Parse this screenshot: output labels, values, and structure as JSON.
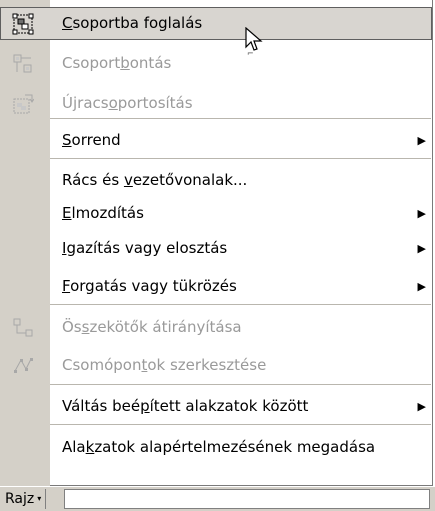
{
  "menu": {
    "items": [
      {
        "pre": "",
        "u": "C",
        "post": "soportba foglalás",
        "disabled": false,
        "hover": true,
        "submenu": false,
        "icon": "group-icon"
      },
      {
        "pre": "Csoport",
        "u": "b",
        "post": "ontás",
        "disabled": true,
        "hover": false,
        "submenu": false,
        "icon": "ungroup-icon"
      },
      {
        "pre": "Újracs",
        "u": "o",
        "post": "portosítás",
        "disabled": true,
        "hover": false,
        "submenu": false,
        "icon": "regroup-icon"
      },
      {
        "pre": "",
        "u": "S",
        "post": "orrend",
        "disabled": false,
        "hover": false,
        "submenu": true,
        "icon": ""
      },
      {
        "pre": "Rács és ",
        "u": "v",
        "post": "ezetővonalak...",
        "disabled": false,
        "hover": false,
        "submenu": false,
        "icon": ""
      },
      {
        "pre": "",
        "u": "E",
        "post": "lmozdítás",
        "disabled": false,
        "hover": false,
        "submenu": true,
        "icon": ""
      },
      {
        "pre": "",
        "u": "I",
        "post": "gazítás vagy elosztás",
        "disabled": false,
        "hover": false,
        "submenu": true,
        "icon": ""
      },
      {
        "pre": "",
        "u": "F",
        "post": "orgatás vagy tükrözés",
        "disabled": false,
        "hover": false,
        "submenu": true,
        "icon": ""
      },
      {
        "pre": "Ös",
        "u": "s",
        "post": "zekötők átirányítása",
        "disabled": true,
        "hover": false,
        "submenu": false,
        "icon": "reroute-connectors-icon"
      },
      {
        "pre": "Csomópon",
        "u": "t",
        "post": "ok szerkesztése",
        "disabled": true,
        "hover": false,
        "submenu": false,
        "icon": "edit-points-icon"
      },
      {
        "pre": "Váltás beé",
        "u": "p",
        "post": "ített alakzatok között",
        "disabled": false,
        "hover": false,
        "submenu": true,
        "icon": ""
      },
      {
        "pre": "Ala",
        "u": "k",
        "post": "zatok alapértelmezésének megadása",
        "disabled": false,
        "hover": false,
        "submenu": false,
        "icon": ""
      }
    ]
  },
  "toolbar": {
    "rajz_label": "Rajz",
    "dropdown_glyph": "▾"
  },
  "colors": {
    "gutter": "#d4d0c8",
    "disabled_text": "#9a9a9a",
    "hover_bg": "#d8d5d0"
  }
}
